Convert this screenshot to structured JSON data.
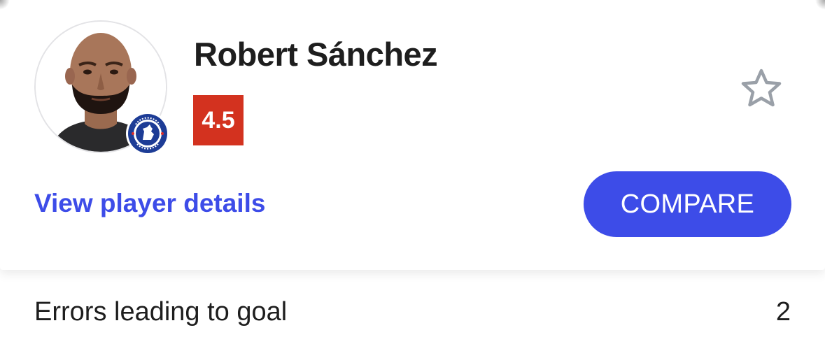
{
  "player": {
    "name": "Robert Sánchez",
    "rating": "4.5",
    "club_badge_text": "CHELSEA FOOTBALL CLUB"
  },
  "actions": {
    "details_link": "View player details",
    "compare_button": "COMPARE"
  },
  "stats": [
    {
      "label": "Errors leading to goal",
      "value": "2"
    }
  ],
  "icons": {
    "favorite": "star-outline-icon",
    "club": "chelsea-crest-icon"
  },
  "colors": {
    "accent": "#3d4ce8",
    "rating_bg": "#d3321f",
    "text": "#1e1e1e",
    "star": "#9aa0a8"
  }
}
